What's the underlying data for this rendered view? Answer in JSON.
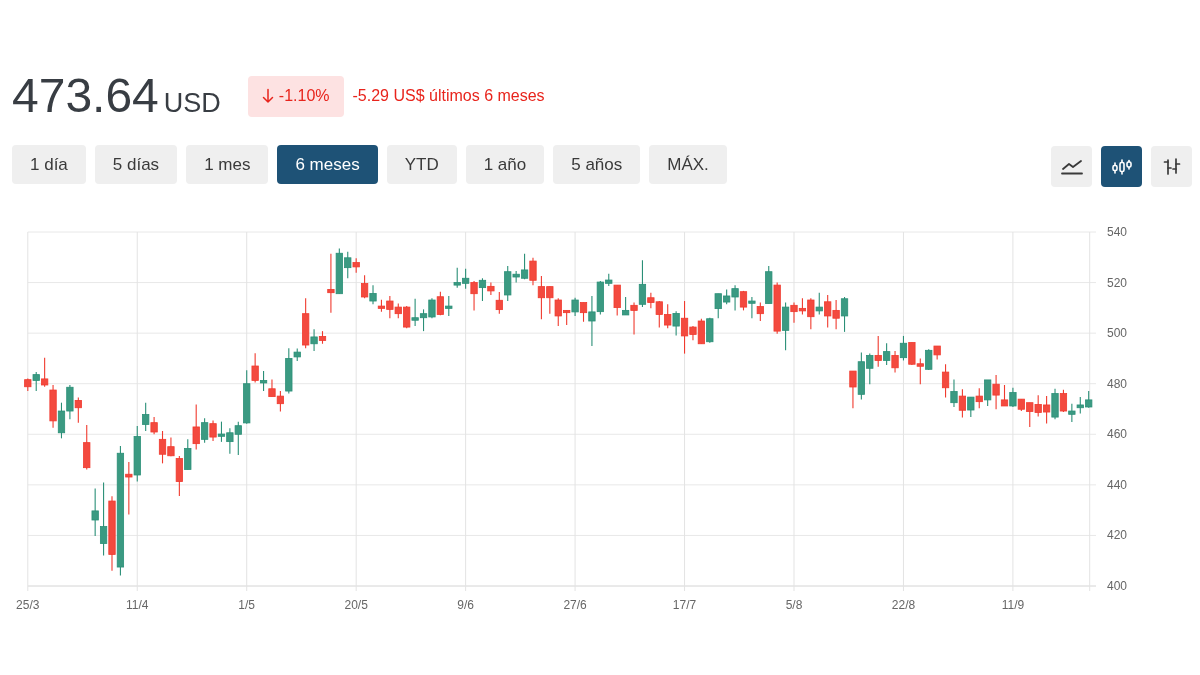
{
  "quote": {
    "price": "473.64",
    "currency": "USD",
    "negative": true,
    "change_percent": "-1.10%",
    "change_summary": "-5.29 US$ últimos 6 meses"
  },
  "range_tabs": [
    {
      "label": "1 día",
      "selected": false
    },
    {
      "label": "5 días",
      "selected": false
    },
    {
      "label": "1 mes",
      "selected": false
    },
    {
      "label": "6 meses",
      "selected": true
    },
    {
      "label": "YTD",
      "selected": false
    },
    {
      "label": "1 año",
      "selected": false
    },
    {
      "label": "5 años",
      "selected": false
    },
    {
      "label": "MÁX.",
      "selected": false
    }
  ],
  "chart_types": [
    {
      "kind": "line",
      "selected": false
    },
    {
      "kind": "candlestick",
      "selected": true
    },
    {
      "kind": "ohlc",
      "selected": false
    }
  ],
  "chart": {
    "chart_data": {
      "type": "candlestick",
      "grid": true,
      "categories": [
        "25/3",
        null,
        null,
        null,
        null,
        null,
        null,
        null,
        null,
        null,
        null,
        null,
        null,
        "11/4",
        null,
        null,
        null,
        null,
        null,
        null,
        null,
        null,
        null,
        null,
        null,
        null,
        "1/5",
        null,
        null,
        null,
        null,
        null,
        null,
        null,
        null,
        null,
        null,
        null,
        null,
        "20/5",
        null,
        null,
        null,
        null,
        null,
        null,
        null,
        null,
        null,
        null,
        null,
        null,
        "9/6",
        null,
        null,
        null,
        null,
        null,
        null,
        null,
        null,
        null,
        null,
        null,
        null,
        "27/6",
        null,
        null,
        null,
        null,
        null,
        null,
        null,
        null,
        null,
        null,
        null,
        null,
        "17/7",
        null,
        null,
        null,
        null,
        null,
        null,
        null,
        null,
        null,
        null,
        null,
        null,
        "5/8",
        null,
        null,
        null,
        null,
        null,
        null,
        null,
        null,
        null,
        null,
        null,
        null,
        "22/8",
        null,
        null,
        null,
        null,
        null,
        null,
        null,
        null,
        null,
        null,
        null,
        null,
        "11/9",
        null,
        null,
        null,
        null,
        null,
        null,
        null,
        null,
        null
      ],
      "ohlc": [
        [
          481.6,
          482.1,
          477.1,
          478.8
        ],
        [
          481.3,
          484.6,
          477.1,
          483.6
        ],
        [
          481.9,
          490.3,
          478.8,
          479.5
        ],
        [
          477.5,
          479.5,
          462.6,
          465.3
        ],
        [
          460.6,
          472.5,
          458.4,
          469.2
        ],
        [
          469.2,
          479.5,
          465.9,
          478.6
        ],
        [
          473.4,
          474.5,
          464.6,
          470.5
        ],
        [
          456.7,
          463.7,
          446.1,
          446.8
        ],
        [
          426.1,
          438.6,
          419.8,
          429.7
        ],
        [
          416.8,
          440.9,
          412.1,
          423.5
        ],
        [
          433.6,
          435.5,
          406,
          412.5
        ],
        [
          407.5,
          455.4,
          404.2,
          452.5
        ],
        [
          444.2,
          449,
          428.3,
          443.1
        ],
        [
          443.9,
          463.3,
          441.3,
          459.1
        ],
        [
          463.9,
          472.5,
          461.3,
          467.8
        ],
        [
          464.6,
          466.8,
          460,
          460.9
        ],
        [
          458,
          461.3,
          448.5,
          452.1
        ],
        [
          455.1,
          458.7,
          451.3,
          451.5
        ],
        [
          450.4,
          451.4,
          435.6,
          441.3
        ],
        [
          446.1,
          458,
          446.1,
          454.4
        ],
        [
          462.9,
          471.8,
          454,
          456.3
        ],
        [
          458,
          466.3,
          456.7,
          464.6
        ],
        [
          464.2,
          465.5,
          457.3,
          458.9
        ],
        [
          459.2,
          465,
          457,
          460.1
        ],
        [
          457.1,
          462.4,
          452.3,
          460.6
        ],
        [
          460,
          465,
          451.8,
          463.4
        ],
        [
          464.5,
          485.3,
          464.2,
          480
        ],
        [
          487,
          492,
          480.5,
          481.3
        ],
        [
          480.3,
          485,
          477.1,
          481.3
        ],
        [
          478,
          481.7,
          474.9,
          474.9
        ],
        [
          475.1,
          477.1,
          469,
          472.1
        ],
        [
          477.1,
          494,
          476.1,
          490
        ],
        [
          490.6,
          493.9,
          489,
          492.5
        ],
        [
          507.7,
          513.8,
          494,
          495.3
        ],
        [
          495.8,
          501.5,
          492.9,
          498.5
        ],
        [
          498.7,
          500.8,
          495.8,
          497.1
        ],
        [
          517.3,
          531.4,
          508.1,
          516
        ],
        [
          515.6,
          533.5,
          515.6,
          531.6
        ],
        [
          525.9,
          532.2,
          521.7,
          529.8
        ],
        [
          527.9,
          529.6,
          523.9,
          526.2
        ],
        [
          519.6,
          522.9,
          513.8,
          514.3
        ],
        [
          512.7,
          518.9,
          511.4,
          515.7
        ],
        [
          510.7,
          513.2,
          508.5,
          509.8
        ],
        [
          512.7,
          514.7,
          505.9,
          509.4
        ],
        [
          510.3,
          511.7,
          505.9,
          507.7
        ],
        [
          510.3,
          510.7,
          501.9,
          502.4
        ],
        [
          505.1,
          513.6,
          502.8,
          506.1
        ],
        [
          506.1,
          509.4,
          500.8,
          507.7
        ],
        [
          506.4,
          513.8,
          505.9,
          513.1
        ],
        [
          514.4,
          516.4,
          507.1,
          507.4
        ],
        [
          509.8,
          514.7,
          506.8,
          510.7
        ],
        [
          519,
          525.9,
          518,
          520
        ],
        [
          519.7,
          525.5,
          517.6,
          521.7
        ],
        [
          520,
          520.6,
          509,
          515.6
        ],
        [
          518,
          521.7,
          512.7,
          520.9
        ],
        [
          518.5,
          520,
          515.1,
          516.7
        ],
        [
          513,
          516.3,
          507.7,
          509.3
        ],
        [
          515.1,
          526.6,
          512.7,
          524.3
        ],
        [
          522.2,
          524.6,
          520,
          523.3
        ],
        [
          521.7,
          531.4,
          521.3,
          525
        ],
        [
          528.5,
          529.8,
          518.9,
          520.9
        ],
        [
          518.4,
          522.6,
          505.5,
          514
        ],
        [
          518.4,
          518.4,
          507.7,
          514
        ],
        [
          513.1,
          513.8,
          502.8,
          506.8
        ],
        [
          509,
          509,
          503.2,
          508.1
        ],
        [
          508.4,
          514,
          506.8,
          513.1
        ],
        [
          512.1,
          512.1,
          504.5,
          508.1
        ],
        [
          504.8,
          514.7,
          494.9,
          508.4
        ],
        [
          508.5,
          520.6,
          507.4,
          520.2
        ],
        [
          519.7,
          523.5,
          518.6,
          521
        ],
        [
          519,
          519,
          507,
          510.1
        ],
        [
          507.2,
          514.3,
          507.2,
          509
        ],
        [
          511,
          512.1,
          499.5,
          509
        ],
        [
          511.4,
          528.8,
          510.3,
          519.3
        ],
        [
          514,
          516,
          509.8,
          512.1
        ],
        [
          512.4,
          512.7,
          502.2,
          507.4
        ],
        [
          507.4,
          511.4,
          501.9,
          503.2
        ],
        [
          502.8,
          508.7,
          499.1,
          507.8
        ],
        [
          505.9,
          512.7,
          491.9,
          498.9
        ],
        [
          502.4,
          502.8,
          497.2,
          499.5
        ],
        [
          504.8,
          505.7,
          495.8,
          495.8
        ],
        [
          496.6,
          506.1,
          496.2,
          505.7
        ],
        [
          509.7,
          515.6,
          505.9,
          515.6
        ],
        [
          512.3,
          517.3,
          511.4,
          514.7
        ],
        [
          514.3,
          518.9,
          509,
          517.6
        ],
        [
          516.4,
          516.7,
          509,
          510.3
        ],
        [
          511.8,
          514.3,
          505.9,
          512.7
        ],
        [
          510.5,
          512.1,
          504.8,
          507.7
        ],
        [
          511.7,
          526.6,
          511.7,
          524.3
        ],
        [
          519,
          520,
          499.8,
          500.8
        ],
        [
          501.1,
          512.1,
          493.2,
          510.3
        ],
        [
          511,
          512.1,
          504.1,
          508.5
        ],
        [
          509.8,
          513.8,
          507.4,
          508.8
        ],
        [
          513.1,
          513.8,
          501.5,
          506.5
        ],
        [
          508.8,
          516,
          507.4,
          510.3
        ],
        [
          512.4,
          515.1,
          502.2,
          506.8
        ],
        [
          509,
          513.1,
          501.5,
          505.9
        ],
        [
          506.8,
          514.3,
          500.5,
          513.6
        ],
        [
          485,
          485,
          470.3,
          478.7
        ],
        [
          475.8,
          492.3,
          473.8,
          488.7
        ],
        [
          486.1,
          491.9,
          479.8,
          491.2
        ],
        [
          491.2,
          498.9,
          486.7,
          489.2
        ],
        [
          489.2,
          496,
          487.4,
          492.7
        ],
        [
          491.2,
          492.9,
          484.4,
          486.3
        ],
        [
          490.3,
          498.9,
          489.2,
          496
        ],
        [
          496.3,
          496.3,
          487.4,
          487.7
        ],
        [
          487.9,
          490,
          479.8,
          486.9
        ],
        [
          485.7,
          493.6,
          485.4,
          493.2
        ],
        [
          494.9,
          494.9,
          489.6,
          491.4
        ],
        [
          484.6,
          487.7,
          474.5,
          478.4
        ],
        [
          472.5,
          481.7,
          470.8,
          476.9
        ],
        [
          475.1,
          477.8,
          466.6,
          469.5
        ],
        [
          469.6,
          474.7,
          466.8,
          474.7
        ],
        [
          475.1,
          478.2,
          470.3,
          472.9
        ],
        [
          473.6,
          481.5,
          471.2,
          481.5
        ],
        [
          479.8,
          483.4,
          469.9,
          475.5
        ],
        [
          473.6,
          479.5,
          471.2,
          471.2
        ],
        [
          471.2,
          478.4,
          470.8,
          476.5
        ],
        [
          473.9,
          473.9,
          469.2,
          469.9
        ],
        [
          472.5,
          472.5,
          462.9,
          469
        ],
        [
          471.8,
          475.4,
          467,
          468.6
        ],
        [
          471.6,
          475.1,
          464.3,
          468.8
        ],
        [
          466.8,
          478,
          465.9,
          476.1
        ],
        [
          476.1,
          477.6,
          468.8,
          469.2
        ],
        [
          467.9,
          472.1,
          464.9,
          469.2
        ],
        [
          470.5,
          474.7,
          468.2,
          471.6
        ],
        [
          470.8,
          477.1,
          470.5,
          473.6
        ]
      ],
      "ylim": [
        400,
        540
      ],
      "yticks": [
        540,
        520,
        500,
        480,
        460,
        440,
        420,
        400
      ]
    }
  }
}
